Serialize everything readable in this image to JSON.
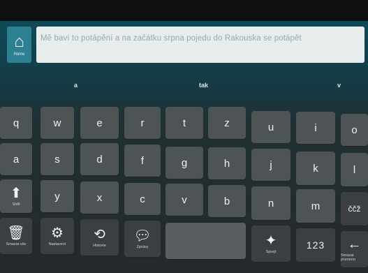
{
  "input": {
    "text": "Mě baví to potápění a na začátku srpna pojedu do Rakouska se potápět",
    "home_label": "Home"
  },
  "suggestions": [
    "a",
    "tak",
    "v"
  ],
  "keyboard": {
    "row1": [
      "q",
      "w",
      "e",
      "r",
      "t",
      "z",
      "u",
      "i",
      "o"
    ],
    "row2": [
      "a",
      "s",
      "d",
      "f",
      "g",
      "h",
      "j",
      "k",
      "l"
    ],
    "row3": [
      "y",
      "x",
      "c",
      "v",
      "b",
      "n",
      "m",
      "ččž"
    ],
    "shift_label": "Shift",
    "clear_label": "Smazat vše",
    "settings_label": "Nastavení",
    "history_label": "Historie",
    "phrases_label": "Zprávy",
    "speak_label": "Sprejt",
    "numbers_label": "123",
    "delete_label": "Smazat písmeno"
  }
}
